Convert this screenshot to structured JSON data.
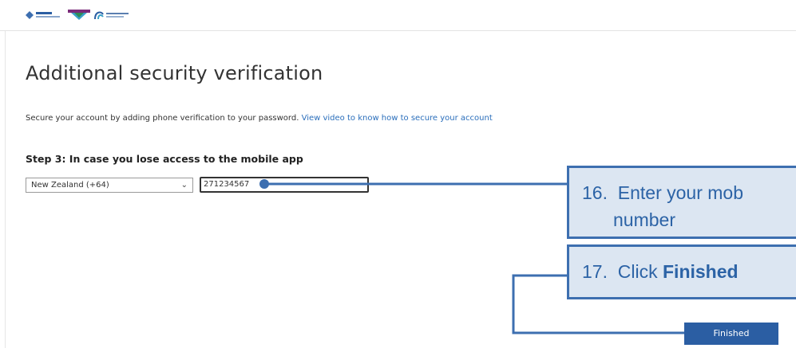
{
  "header": {
    "logos": [
      "org-logo-1",
      "org-logo-2",
      "org-logo-3"
    ]
  },
  "page": {
    "title": "Additional security verification",
    "description_text": "Secure your account by adding phone verification to your password.",
    "video_link": "View video to know how to secure your account"
  },
  "step": {
    "heading": "Step 3: In case you lose access to the mobile app",
    "country_select": "New Zealand (+64)",
    "phone_value": "271234567"
  },
  "callouts": {
    "step16_number": "16.",
    "step16_text": "Enter your mob",
    "step16_text2": "number",
    "step17_number": "17.",
    "step17_text": "Click",
    "step17_bold": "Finished"
  },
  "buttons": {
    "finished": "Finished"
  },
  "colors": {
    "accent": "#2b5ea3",
    "callout_fill": "#dce6f2",
    "callout_border": "#3d6fb0",
    "link": "#2a6ebb"
  }
}
